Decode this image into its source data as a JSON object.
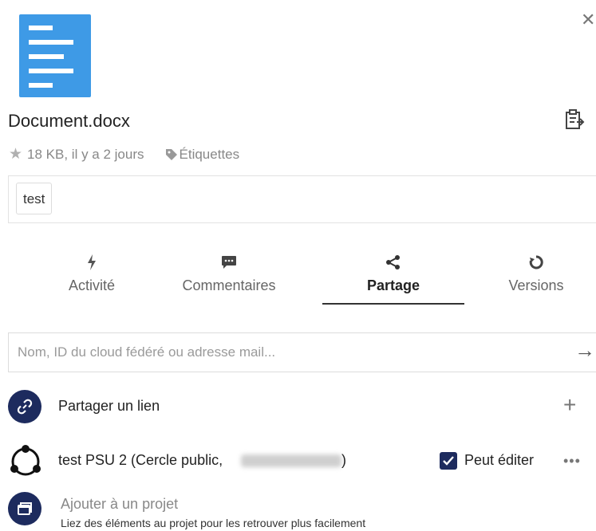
{
  "panel": {
    "close_icon": "close-icon"
  },
  "file": {
    "name": "Document.docx",
    "thumb_color": "#3e9ae6",
    "size_date": "18 KB, il y a 2 jours",
    "tags_label": "Étiquettes",
    "tags": [
      "test"
    ]
  },
  "tabs": [
    {
      "label": "Activité",
      "icon": "bolt-icon",
      "active": false
    },
    {
      "label": "Commentaires",
      "icon": "comment-icon",
      "active": false
    },
    {
      "label": "Partage",
      "icon": "share-icon",
      "active": true
    },
    {
      "label": "Versions",
      "icon": "history-icon",
      "active": false
    }
  ],
  "share": {
    "search_placeholder": "Nom, ID du cloud fédéré ou adresse mail...",
    "link_label": "Partager un lien",
    "circle_name_prefix": "test PSU 2 (Cercle public,",
    "circle_name_suffix": ")",
    "permission_label": "Peut éditer",
    "permission_checked": true,
    "project_title": "Ajouter à un projet",
    "project_subtitle": "Liez des éléments au projet pour les retrouver plus facilement"
  },
  "colors": {
    "accent": "#1d2b5e",
    "file_blue": "#3e9ae6"
  }
}
